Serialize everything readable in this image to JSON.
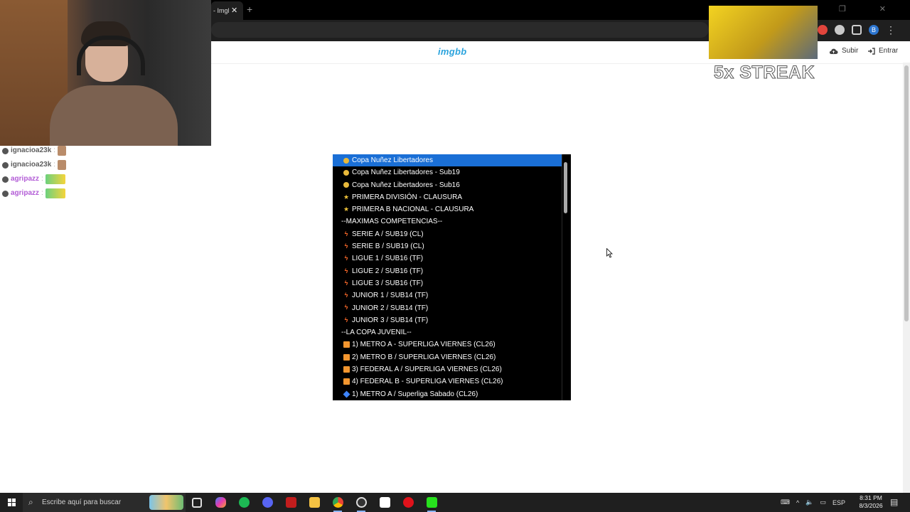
{
  "browser": {
    "tab_label": "- Imgl",
    "tab_close": "✕",
    "new_tab": "+",
    "window_controls": "— ❐ ✕"
  },
  "page": {
    "logo": "imgbb",
    "upload_label": "Subir",
    "login_label": "Entrar"
  },
  "dropdown": {
    "options": [
      {
        "icon": "medal",
        "label": "Copa Nuñez Libertadores",
        "selected": true
      },
      {
        "icon": "medal",
        "label": "Copa Nuñez Libertadores - Sub19"
      },
      {
        "icon": "medal",
        "label": "Copa Nuñez Libertadores - Sub16"
      },
      {
        "icon": "star",
        "label": "PRIMERA DIVISIÓN - CLAUSURA"
      },
      {
        "icon": "star",
        "label": "PRIMERA B NACIONAL - CLAUSURA"
      },
      {
        "icon": "none",
        "label": "--MAXIMAS COMPETENCIAS--",
        "header": true
      },
      {
        "icon": "bolt",
        "label": "SERIE A / SUB19 (CL)"
      },
      {
        "icon": "bolt",
        "label": "SERIE B / SUB19 (CL)"
      },
      {
        "icon": "bolt",
        "label": "LIGUE 1 / SUB16 (TF)"
      },
      {
        "icon": "bolt",
        "label": "LIGUE 2 / SUB16 (TF)"
      },
      {
        "icon": "bolt",
        "label": "LIGUE 3 / SUB16 (TF)"
      },
      {
        "icon": "bolt",
        "label": "JUNIOR 1 / SUB14 (TF)"
      },
      {
        "icon": "bolt",
        "label": "JUNIOR 2 / SUB14 (TF)"
      },
      {
        "icon": "bolt",
        "label": "JUNIOR 3 / SUB14 (TF)"
      },
      {
        "icon": "none",
        "label": "--LA COPA JUVENIL--",
        "header": true
      },
      {
        "icon": "square",
        "label": "1) METRO A - SUPERLIGA VIERNES (CL26)"
      },
      {
        "icon": "square",
        "label": "2) METRO B / SUPERLIGA VIERNES (CL26)"
      },
      {
        "icon": "square",
        "label": "3) FEDERAL A / SUPERLIGA VIERNES (CL26)"
      },
      {
        "icon": "square",
        "label": "4) FEDERAL B - SUPERLIGA VIERNES (CL26)"
      },
      {
        "icon": "diamond",
        "label": "1) METRO A / Superliga Sabado (CL26)"
      }
    ]
  },
  "overlay": {
    "chat": [
      {
        "user": "ignacioa23k",
        "sep": ":",
        "style": "c1",
        "emote": "a"
      },
      {
        "user": "ignacioa23k",
        "sep": ":",
        "style": "c1",
        "emote": "a"
      },
      {
        "user": "agripazz",
        "sep": ":",
        "style": "c2",
        "emote": "b"
      },
      {
        "user": "agripazz",
        "sep": ":",
        "style": "c2",
        "emote": "b"
      }
    ],
    "streak": "5x STREAK"
  },
  "taskbar": {
    "search_placeholder": "Escribe aquí para buscar",
    "tray_lang": "ESP",
    "time": "8:31 PM",
    "date": "8/3/2026"
  },
  "colors": {
    "selected": "#1a6fd6",
    "logo": "#2aa3dd",
    "taskbar": "#1f1f1f"
  }
}
